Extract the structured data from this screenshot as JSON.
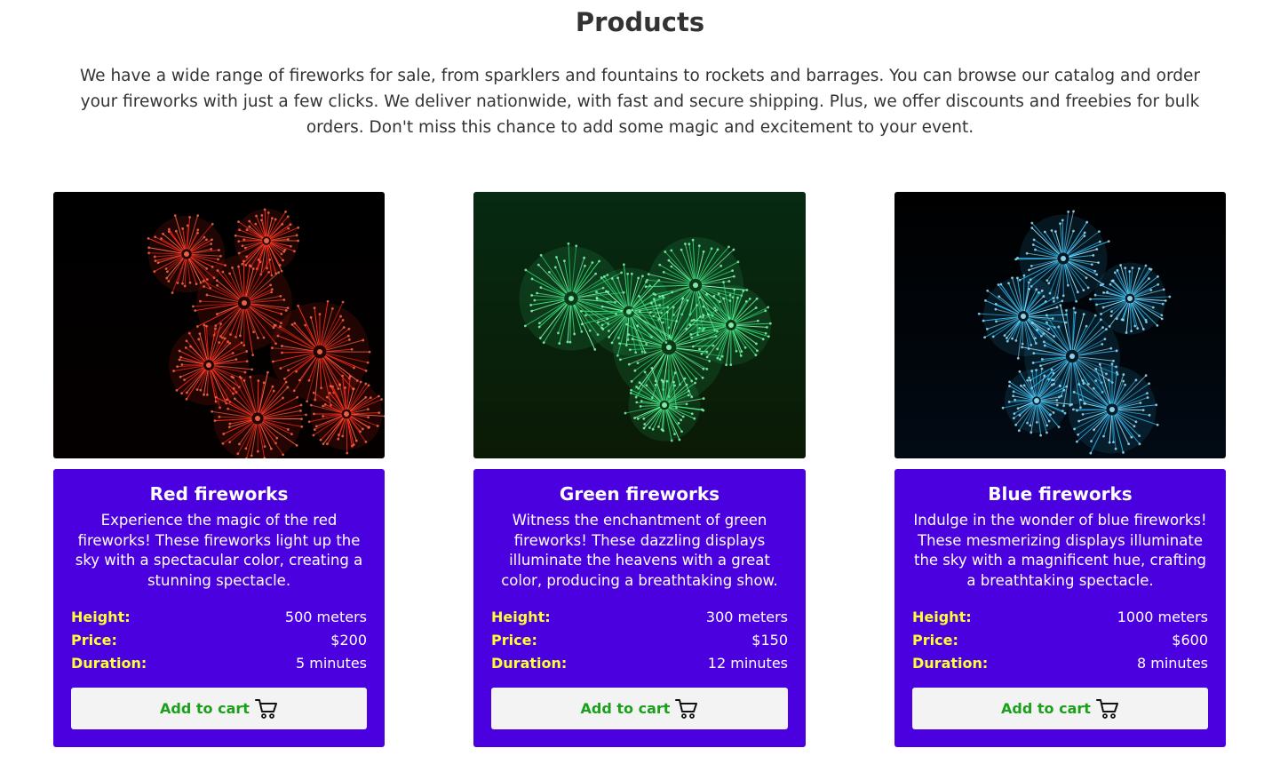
{
  "page": {
    "title": "Products",
    "intro": "We have a wide range of fireworks for sale, from sparklers and fountains to rockets and barrages. You can browse our catalog and order your fireworks with just a few clicks. We deliver nationwide, with fast and secure shipping. Plus, we offer discounts and freebies for bulk orders. Don't miss this chance to add some magic and excitement to your event."
  },
  "colors": {
    "card_background": "#4b00e0",
    "spec_label": "#ffff33",
    "button_text": "#1aa01a",
    "button_background": "#f3f3f3"
  },
  "products": [
    {
      "image": "red-fireworks-photo",
      "title": "Red fireworks",
      "description": "Experience the magic of the red fireworks! These fireworks light up the sky with a spectacular color, creating a stunning spectacle.",
      "height_label": "Height:",
      "height": "500 meters",
      "price_label": "Price:",
      "price": "$200",
      "duration_label": "Duration:",
      "duration": "5 minutes",
      "button_label": "Add to cart",
      "button_icon": "shopping-cart-icon"
    },
    {
      "image": "green-fireworks-photo",
      "title": "Green fireworks",
      "description": "Witness the enchantment of green fireworks! These dazzling displays illuminate the heavens with a great color, producing a breathtaking show.",
      "height_label": "Height:",
      "height": "300 meters",
      "price_label": "Price:",
      "price": "$150",
      "duration_label": "Duration:",
      "duration": "12 minutes",
      "button_label": "Add to cart",
      "button_icon": "shopping-cart-icon"
    },
    {
      "image": "blue-fireworks-photo",
      "title": "Blue fireworks",
      "description": "Indulge in the wonder of blue fireworks! These mesmerizing displays illuminate the sky with a magnificent hue, crafting a breathtaking spectacle.",
      "height_label": "Height:",
      "height": "1000 meters",
      "price_label": "Price:",
      "price": "$600",
      "duration_label": "Duration:",
      "duration": "8 minutes",
      "button_label": "Add to cart",
      "button_icon": "shopping-cart-icon"
    }
  ]
}
